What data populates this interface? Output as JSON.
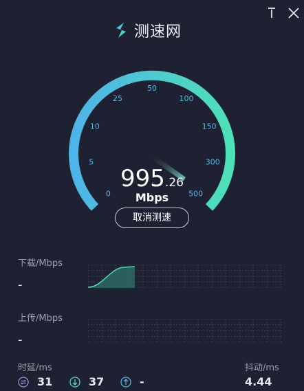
{
  "app": {
    "title": "测速网"
  },
  "speed": {
    "integer": "995",
    "decimal": ".26",
    "unit": "Mbps"
  },
  "gauge": {
    "ticks": [
      "0",
      "5",
      "10",
      "25",
      "50",
      "100",
      "150",
      "300",
      "500"
    ],
    "accent_start": "#4fb3e8",
    "accent_end": "#4ee0b8",
    "tick_color": "#5ab6e6"
  },
  "actions": {
    "cancel_label": "取消测速"
  },
  "download": {
    "label": "下载/Mbps",
    "value": "-"
  },
  "upload": {
    "label": "上传/Mbps",
    "value": "-"
  },
  "latency": {
    "label": "时延/ms",
    "ping": "31",
    "down": "37",
    "up": "-"
  },
  "jitter": {
    "label": "抖动/ms",
    "value": "4.44"
  }
}
